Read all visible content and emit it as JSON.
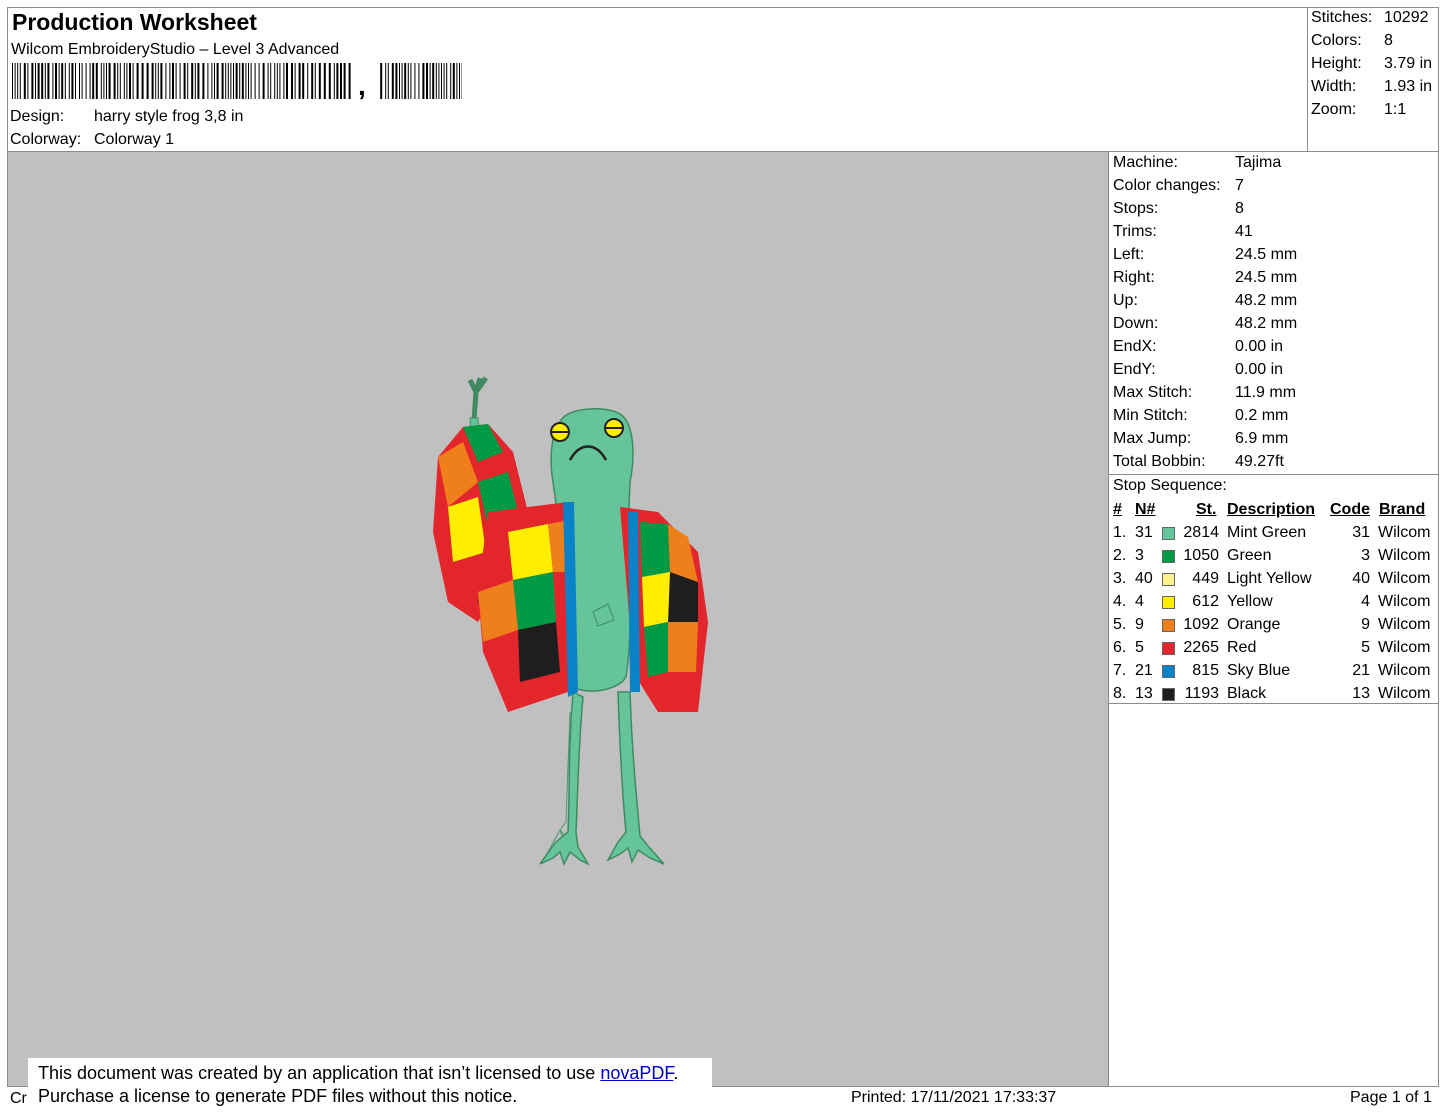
{
  "header": {
    "title": "Production Worksheet",
    "subtitle": "Wilcom EmbroideryStudio – Level 3 Advanced",
    "barcode_suffix": ",",
    "design_label": "Design:",
    "design_value": "harry style frog 3,8 in",
    "colorway_label": "Colorway:",
    "colorway_value": "Colorway 1"
  },
  "stats": [
    {
      "label": "Stitches:",
      "value": "10292"
    },
    {
      "label": "Colors:",
      "value": "8"
    },
    {
      "label": "Height:",
      "value": "3.79 in"
    },
    {
      "label": "Width:",
      "value": "1.93 in"
    },
    {
      "label": "Zoom:",
      "value": "1:1"
    }
  ],
  "properties": [
    {
      "label": "Machine:",
      "value": "Tajima"
    },
    {
      "label": "Color changes:",
      "value": "7"
    },
    {
      "label": "Stops:",
      "value": "8"
    },
    {
      "label": "Trims:",
      "value": "41"
    },
    {
      "label": "Left:",
      "value": "24.5 mm"
    },
    {
      "label": "Right:",
      "value": "24.5 mm"
    },
    {
      "label": "Up:",
      "value": "48.2 mm"
    },
    {
      "label": "Down:",
      "value": "48.2 mm"
    },
    {
      "label": "EndX:",
      "value": "0.00 in"
    },
    {
      "label": "EndY:",
      "value": "0.00 in"
    },
    {
      "label": "Max Stitch:",
      "value": "11.9 mm"
    },
    {
      "label": "Min Stitch:",
      "value": "0.2 mm"
    },
    {
      "label": "Max Jump:",
      "value": "6.9 mm"
    },
    {
      "label": "Total Bobbin:",
      "value": "49.27ft"
    }
  ],
  "stop_sequence": {
    "title": "Stop Sequence:",
    "headers": {
      "num": "#",
      "n": "N#",
      "st": "St.",
      "desc": "Description",
      "code": "Code",
      "brand": "Brand"
    },
    "rows": [
      {
        "num": "1.",
        "n": "31",
        "color": "#66c49a",
        "st": "2814",
        "desc": "Mint Green",
        "code": "31",
        "brand": "Wilcom"
      },
      {
        "num": "2.",
        "n": "3",
        "color": "#009a44",
        "st": "1050",
        "desc": "Green",
        "code": "3",
        "brand": "Wilcom"
      },
      {
        "num": "3.",
        "n": "40",
        "color": "#fff28c",
        "st": "449",
        "desc": "Light Yellow",
        "code": "40",
        "brand": "Wilcom"
      },
      {
        "num": "4.",
        "n": "4",
        "color": "#ffee00",
        "st": "612",
        "desc": "Yellow",
        "code": "4",
        "brand": "Wilcom"
      },
      {
        "num": "5.",
        "n": "9",
        "color": "#ee7f1b",
        "st": "1092",
        "desc": "Orange",
        "code": "9",
        "brand": "Wilcom"
      },
      {
        "num": "6.",
        "n": "5",
        "color": "#e3262b",
        "st": "2265",
        "desc": "Red",
        "code": "5",
        "brand": "Wilcom"
      },
      {
        "num": "7.",
        "n": "21",
        "color": "#0a82c8",
        "st": "815",
        "desc": "Sky Blue",
        "code": "21",
        "brand": "Wilcom"
      },
      {
        "num": "8.",
        "n": "13",
        "color": "#1e1e1e",
        "st": "1193",
        "desc": "Black",
        "code": "13",
        "brand": "Wilcom"
      }
    ]
  },
  "notice": {
    "line1_prefix": "This document was created by an application that isn’t licensed to use ",
    "link": "novaPDF",
    "line1_suffix": ".",
    "line2": "Purchase a license to generate PDF files without this notice."
  },
  "footer": {
    "left": "Cr",
    "printed": "Printed: 17/11/2021 17:33:37",
    "page": "Page 1 of 1"
  },
  "preview_background": "#c0c0c0"
}
